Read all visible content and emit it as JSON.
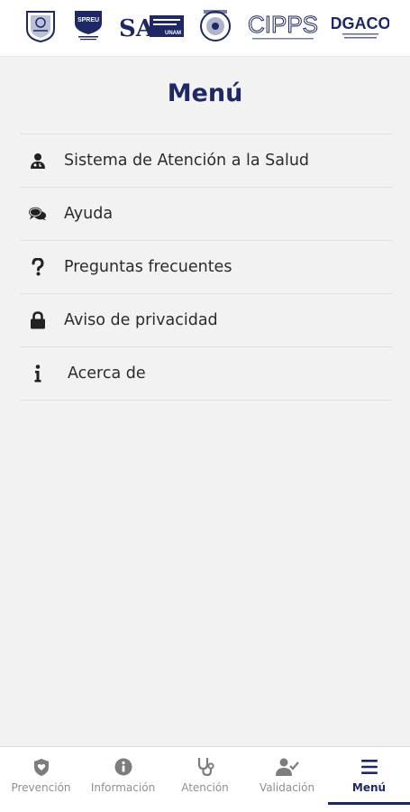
{
  "header": {
    "logos": [
      {
        "name": "unam-shield-logo"
      },
      {
        "name": "spreu-logo",
        "text": "SPREU"
      },
      {
        "name": "sa-unam-logo",
        "text": "SA",
        "subtext": "UNAM"
      },
      {
        "name": "escudo-seal-logo"
      },
      {
        "name": "cipps-logo",
        "text": "CIPPS"
      },
      {
        "name": "dgaco-logo",
        "text": "DGACO"
      }
    ]
  },
  "title": "Menú",
  "menu": {
    "items": [
      {
        "label": "Sistema de Atención a la Salud",
        "icon": "user-doctor-icon"
      },
      {
        "label": "Ayuda",
        "icon": "chat-bubbles-icon"
      },
      {
        "label": "Preguntas frecuentes",
        "icon": "question-icon"
      },
      {
        "label": "Aviso de privacidad",
        "icon": "lock-icon"
      },
      {
        "label": "Acerca de",
        "icon": "info-icon"
      }
    ]
  },
  "bottom_nav": {
    "items": [
      {
        "label": "Prevención",
        "icon": "shield-heart-icon"
      },
      {
        "label": "Información",
        "icon": "info-circle-icon"
      },
      {
        "label": "Atención",
        "icon": "stethoscope-icon"
      },
      {
        "label": "Validación",
        "icon": "user-check-icon"
      },
      {
        "label": "Menú",
        "icon": "hamburger-menu-icon",
        "active": true
      }
    ]
  },
  "colors": {
    "accent": "#1e2866",
    "background": "#f2f2f2",
    "inactive": "#8f8f8f",
    "text": "#2b2b2b"
  }
}
